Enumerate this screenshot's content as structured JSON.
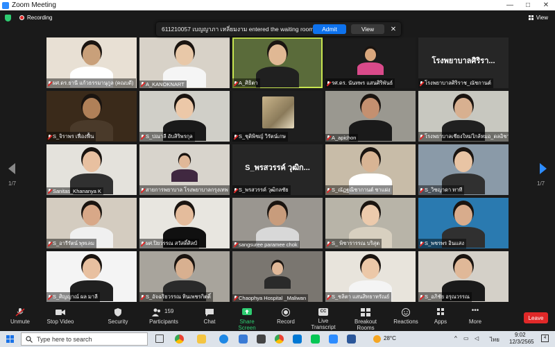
{
  "window": {
    "title": "Zoom Meeting",
    "min": "—",
    "max": "□",
    "close": "✕"
  },
  "topbar": {
    "recording": "Recording",
    "view": "View"
  },
  "notification": {
    "message": "611210057 เบญญาภา เหลี่ยมงาม entered the waiting room",
    "admit": "Admit",
    "view": "View",
    "close": "✕"
  },
  "pager": {
    "left": "1/7",
    "right": "1/7"
  },
  "tiles": [
    {
      "name": "ผศ.ดร.ธานี แก้วธรรมานุกูล (คณบดี)",
      "muted": true,
      "type": "video",
      "bg": "#e8e0d4",
      "skin": "#c9a07a",
      "shirt": "#ffffff"
    },
    {
      "name": "A_KANOKNART",
      "muted": true,
      "type": "video",
      "bg": "#d8d2c8",
      "skin": "#e8c8a8",
      "shirt": "#f5f5f5"
    },
    {
      "name": "A_ศิธิตา",
      "muted": true,
      "type": "video",
      "bg": "#5a6b3a",
      "skin": "#e0b894",
      "shirt": "#202020",
      "active": true
    },
    {
      "name": "รศ.ดร. นันทพร แสนศิริพันธ์",
      "muted": true,
      "type": "video",
      "bg": "#1c1c1c",
      "skin": "#d9a77d",
      "shirt": "#d94a8a",
      "small": true
    },
    {
      "name": "โรงพยาบาลศิริราช_ณัชกานต์",
      "muted": true,
      "type": "text",
      "label": "โรงพยาบาลศิริรา..."
    },
    {
      "name": "S_จิราพร เฟื่องฟื้น",
      "muted": true,
      "type": "video",
      "bg": "#3a2a1a",
      "skin": "#b08058",
      "shirt": "#4a3a2a"
    },
    {
      "name": "S_ปณาลี อับสิริพรกุล",
      "muted": true,
      "type": "video",
      "bg": "#d0cfc8",
      "skin": "#ecc8a8",
      "shirt": "#1a1a1a"
    },
    {
      "name": "S_ชุติพิชญ์ วิรัตน์เกษ",
      "muted": true,
      "type": "image",
      "bg": "#1e1e1e"
    },
    {
      "name": "A_apichon",
      "muted": true,
      "type": "video",
      "bg": "#9a9890",
      "skin": "#c49070",
      "shirt": "#1a1a1a"
    },
    {
      "name": "โรงพยาบาลเชียงใหม่ใกล้หมอ_ดลอิชา",
      "muted": true,
      "type": "video",
      "bg": "#c8c8c0",
      "skin": "#d8b090",
      "shirt": "#202020"
    },
    {
      "name": "Sanitas_Khananya K",
      "muted": true,
      "type": "video",
      "bg": "#e4e2dc",
      "skin": "#e8c0a0",
      "shirt": "#303030"
    },
    {
      "name": "สายการพยาบาล โรงพยาบาลกรุงเทพ",
      "muted": true,
      "type": "video",
      "bg": "#d8d4cc",
      "skin": "#e0b898",
      "shirt": "#402840",
      "small": true
    },
    {
      "name": "S_พรสวรรค์ วุฒิกลชัย",
      "muted": true,
      "type": "text",
      "label": "S_พรสวรรค์ วุฒิก..."
    },
    {
      "name": "S_ณัฏฐณิชากานต์ ชาแฝง",
      "muted": true,
      "type": "video",
      "bg": "#c8bca8",
      "skin": "#d8b494",
      "shirt": "#ffffff"
    },
    {
      "name": "S_วิชญาดา ทาที",
      "muted": true,
      "type": "video",
      "bg": "#8a9aa8",
      "skin": "#e8c4a4",
      "shirt": "#303030"
    },
    {
      "name": "S_อารีรัตน์ พุทเลม",
      "muted": true,
      "type": "video",
      "bg": "#d4ccc0",
      "skin": "#d8a888",
      "shirt": "#f0f0f0"
    },
    {
      "name": "ผศ.ปิยวรรณ สวัสดิ์ศิลป์",
      "muted": true,
      "type": "video",
      "bg": "#e8e6e0",
      "skin": "#e4bc9c",
      "shirt": "#101010"
    },
    {
      "name": "sangsuree paramee chok",
      "muted": true,
      "type": "video",
      "bg": "#9a9690",
      "skin": "#c89c7c",
      "shirt": "#d8d8d8"
    },
    {
      "name": "S_ พิชารารรณ บริสุต",
      "muted": true,
      "type": "video",
      "bg": "#b8b4a8",
      "skin": "#eccaac",
      "shirt": "#d8d0c0"
    },
    {
      "name": "S_พชรพร อินแสง",
      "muted": true,
      "type": "video",
      "bg": "#2a7ab0",
      "skin": "#d8ac8c",
      "shirt": "#303030"
    },
    {
      "name": "S_ศิญญาณ์ ผล มาลี",
      "muted": true,
      "type": "video",
      "bg": "#f4f4f4",
      "skin": "#e8c0a0",
      "shirt": "#202020"
    },
    {
      "name": "S_อัจฉริยวรรณ หินเพชรกิตติ์",
      "muted": true,
      "type": "video",
      "bg": "#a8a49c",
      "skin": "#d8b090",
      "shirt": "#2a2a2a"
    },
    {
      "name": "Chaophya Hospital _Maliwan",
      "muted": true,
      "type": "video",
      "bg": "#7a7670",
      "skin": "#e0b898",
      "shirt": "#2a2a2a",
      "small": true
    },
    {
      "name": "S_ชลิตา แสนสิทธาทรัณย์",
      "muted": true,
      "type": "video",
      "bg": "#e8e4dc",
      "skin": "#ecc8a8",
      "shirt": "#f4f4f4"
    },
    {
      "name": "S_อภิชัย อรุณวรรณ",
      "muted": true,
      "type": "video",
      "bg": "#d4d0c8",
      "skin": "#e0b898",
      "shirt": "#1a1a1a"
    }
  ],
  "toolbar": {
    "unmute": "Unmute",
    "stop_video": "Stop Video",
    "security": "Security",
    "participants": "Participants",
    "participants_count": "159",
    "chat": "Chat",
    "share_screen": "Share Screen",
    "record": "Record",
    "live_transcript": "Live Transcript",
    "cc": "CC",
    "breakout_rooms": "Breakout Rooms",
    "reactions": "Reactions",
    "apps": "Apps",
    "more": "More",
    "leave": "Leave"
  },
  "taskbar": {
    "search_placeholder": "Type here to search",
    "temperature": "28°C",
    "language": "ไทย",
    "time": "9:02",
    "date": "12/3/2565",
    "notif_count": "4"
  },
  "colors": {
    "accent": "#0e72ed",
    "leave": "#e02828",
    "share": "#2ecc71",
    "active_border": "#c8e650"
  }
}
